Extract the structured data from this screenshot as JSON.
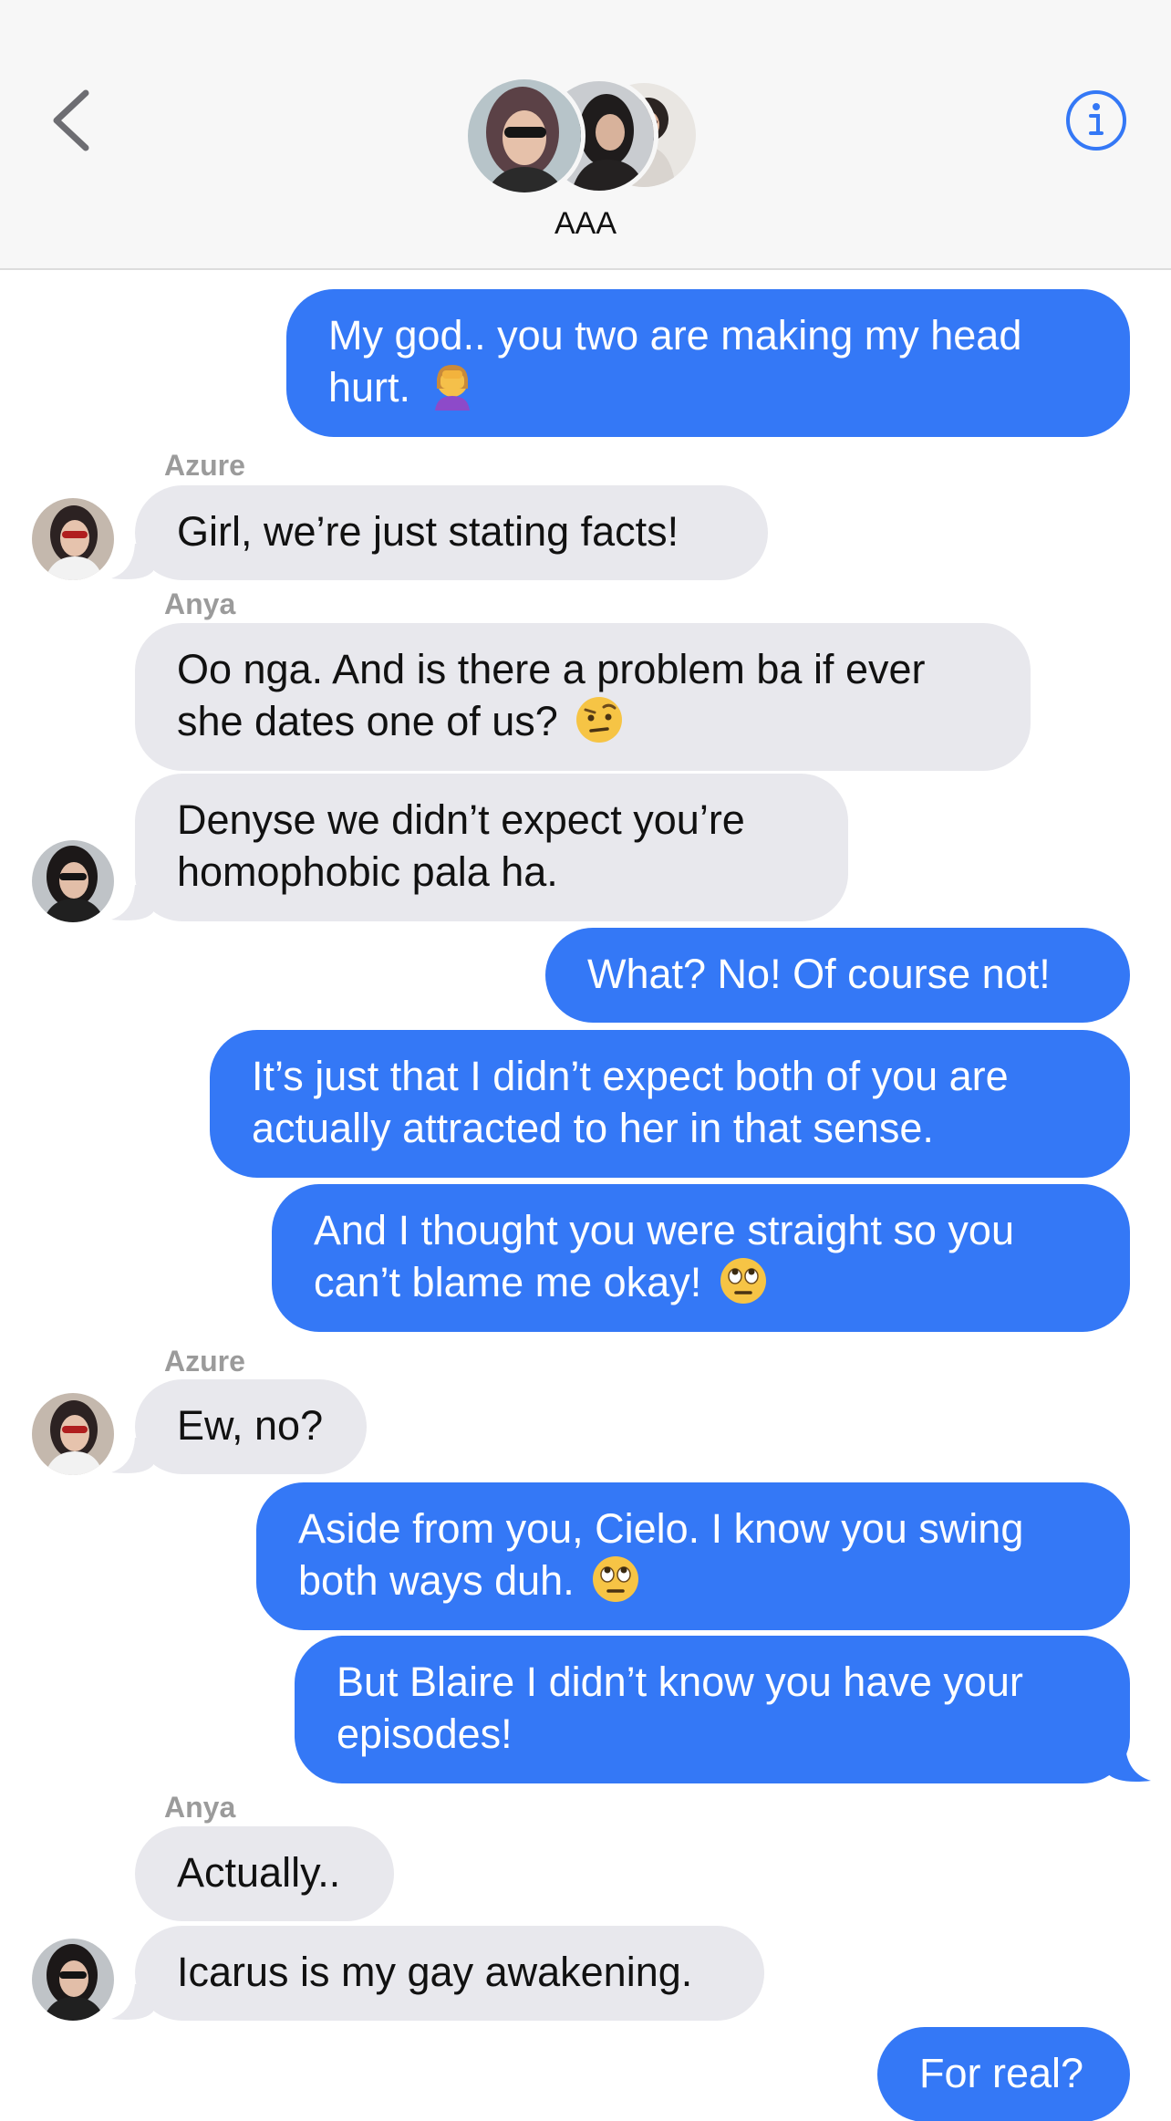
{
  "header": {
    "title": "AAA",
    "back_icon": "chevron-left-icon",
    "info_icon": "info-circle-icon",
    "accent_color": "#3478f6"
  },
  "messages": [
    {
      "direction": "out",
      "text": "My god.. you two are making my head\nhurt. ",
      "emoji": "woman-facepalming"
    },
    {
      "direction": "in",
      "sender": "Azure",
      "text": "Girl, we’re just stating facts!"
    },
    {
      "direction": "in",
      "sender": "Anya",
      "text": "Oo nga. And is there a problem ba if ever\nshe dates one of us? ",
      "emoji": "face-with-raised-eyebrow"
    },
    {
      "direction": "in",
      "text": "Denyse we didn’t expect you’re\nhomophobic pala ha."
    },
    {
      "direction": "out",
      "text": "What? No! Of course not!"
    },
    {
      "direction": "out",
      "text": "It’s just that I didn’t expect both of you are\nactually attracted to her in that sense."
    },
    {
      "direction": "out",
      "text": "And I thought you were straight so you\ncan’t blame me okay! ",
      "emoji": "face-with-rolling-eyes"
    },
    {
      "direction": "in",
      "sender": "Azure",
      "text": "Ew, no?"
    },
    {
      "direction": "out",
      "text": "Aside from you, Cielo. I know you swing\nboth ways duh. ",
      "emoji": "face-with-rolling-eyes"
    },
    {
      "direction": "out",
      "text": "But Blaire I didn’t know you have your\nepisodes!"
    },
    {
      "direction": "in",
      "sender": "Anya",
      "text": "Actually.."
    },
    {
      "direction": "in",
      "text": "Icarus is my gay awakening."
    },
    {
      "direction": "out",
      "text": "For real?"
    }
  ],
  "colors": {
    "outgoing": "#3478f6",
    "incoming": "#e8e8ed",
    "sender_label": "#9b9b9b"
  }
}
